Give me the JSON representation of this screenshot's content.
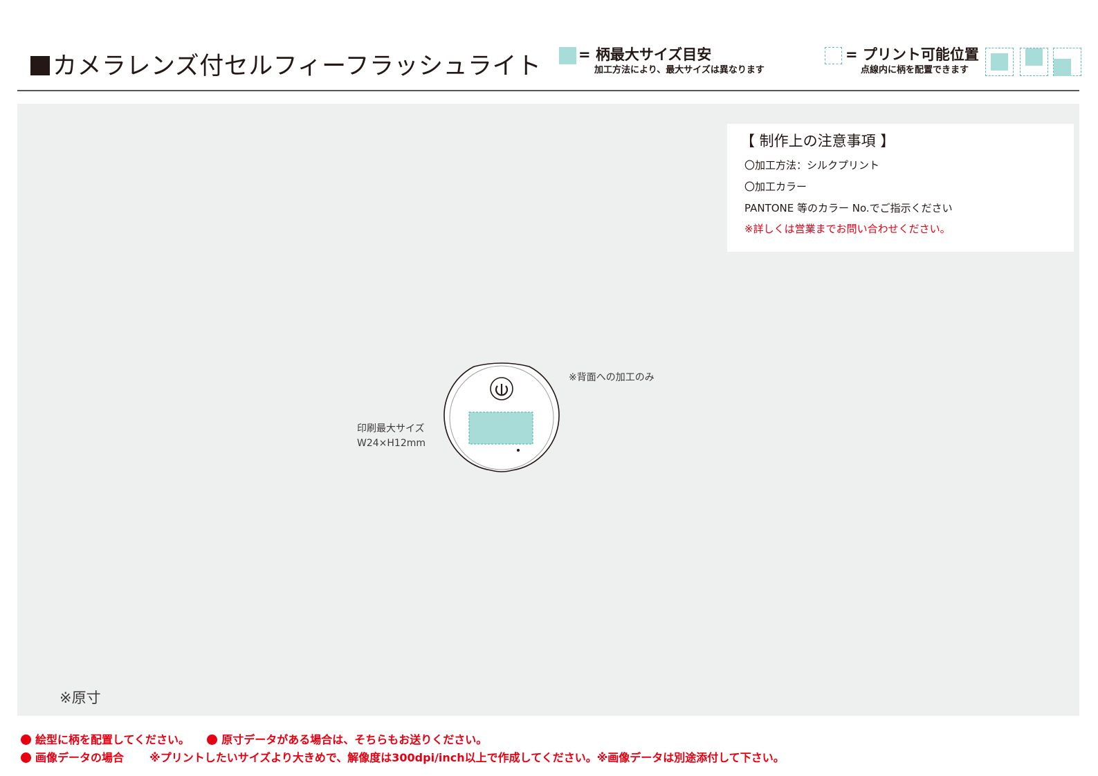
{
  "header": {
    "title": "カメラレンズ付セルフィーフラッシュライト",
    "legend_max_size": {
      "eq": "=",
      "label": "柄最大サイズ目安",
      "sub": "加工方法により、最大サイズは異なります"
    },
    "legend_print_position": {
      "eq": "=",
      "label": "プリント可能位置",
      "sub": "点線内に柄を配置できます"
    }
  },
  "notes": {
    "heading": "【 制作上の注意事項 】",
    "lines": [
      "〇加工方法：シルクプリント",
      "〇加工カラー",
      "PANTONE 等のカラー No.でご指示ください",
      "※詳しくは営業までお問い合わせください。"
    ]
  },
  "drawing": {
    "print_size_label": "印刷最大サイズ",
    "print_size_value": "W24×H12mm",
    "back_only_note": "※背面への加工のみ",
    "actual_size_note": "※原寸"
  },
  "footer": {
    "line1_a": "絵型に柄を配置してください。",
    "line1_b": "原寸データがある場合は、そちらもお送りください。",
    "line2_a": "画像データの場合",
    "line2_b": "※プリントしたいサイズより大きめで、解像度は300dpi/inch以上で作成してください。※画像データは別途添付して下さい。"
  },
  "colors": {
    "accent_teal": "#a8dcd8",
    "dashed_teal": "#5bbdb8",
    "warning_red": "#e60012",
    "panel_gray": "#eeefef"
  }
}
